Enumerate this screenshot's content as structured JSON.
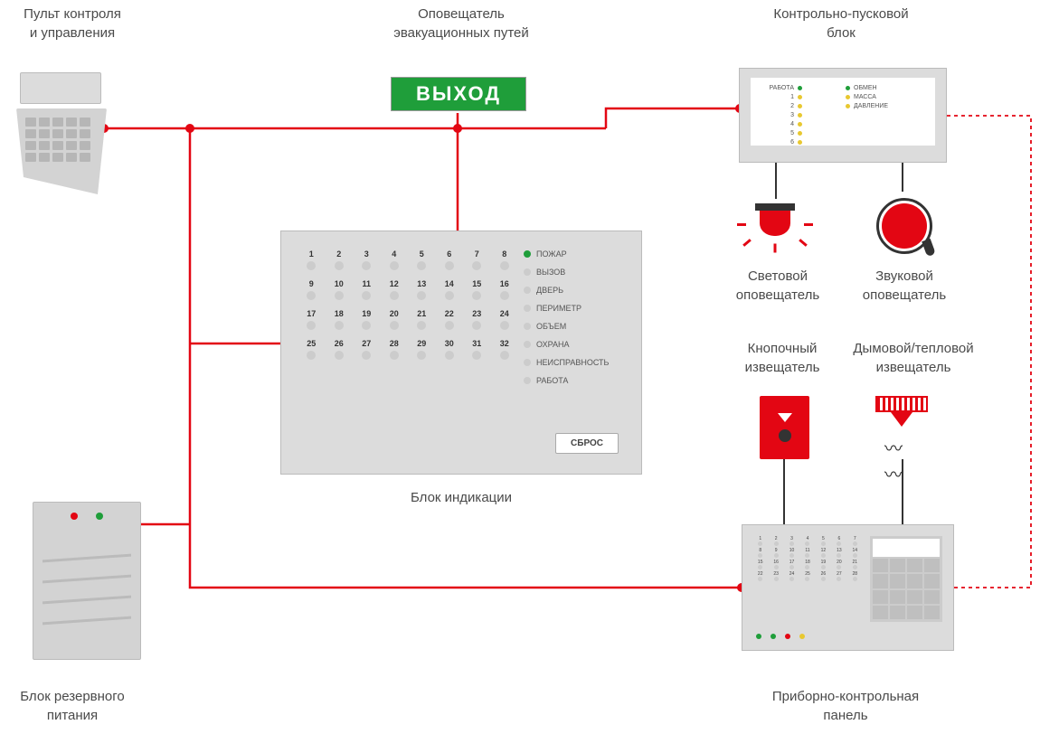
{
  "labels": {
    "keypad": "Пульт контроля\nи управления",
    "exit": "Оповещатель\nэвакуационных путей",
    "ctrl_block": "Контрольно-пусковой\nблок",
    "indication": "Блок индикации",
    "light_ann": "Световой\nоповещатель",
    "sound_ann": "Звуковой\nоповещатель",
    "callpoint": "Кнопочный\nизвещатель",
    "detector": "Дымовой/тепловой\nизвещатель",
    "panel": "Приборно-контрольная\nпанель",
    "ups": "Блок резервного\nпитания"
  },
  "exit_sign_text": "ВЫХОД",
  "ctrl_block": {
    "left_col": [
      "РАБОТА",
      "1",
      "2",
      "3",
      "4",
      "5",
      "6"
    ],
    "right_col": [
      "ОБМЕН",
      "МАССА",
      "ДАВЛЕНИЕ"
    ]
  },
  "indication": {
    "zones": [
      "1",
      "2",
      "3",
      "4",
      "5",
      "6",
      "7",
      "8",
      "9",
      "10",
      "11",
      "12",
      "13",
      "14",
      "15",
      "16",
      "17",
      "18",
      "19",
      "20",
      "21",
      "22",
      "23",
      "24",
      "25",
      "26",
      "27",
      "28",
      "29",
      "30",
      "31",
      "32"
    ],
    "statuses": [
      "ПОЖАР",
      "ВЫЗОВ",
      "ДВЕРЬ",
      "ПЕРИМЕТР",
      "ОБЪЕМ",
      "ОХРАНА",
      "НЕИСПРАВНОСТЬ",
      "РАБОТА"
    ],
    "reset": "СБРОС"
  },
  "panel_numbers": [
    "1",
    "2",
    "3",
    "4",
    "5",
    "6",
    "7",
    "8",
    "9",
    "10",
    "11",
    "12",
    "13",
    "14",
    "15",
    "16",
    "17",
    "18",
    "19",
    "20",
    "21",
    "22",
    "23",
    "24",
    "25",
    "26",
    "27",
    "28"
  ],
  "colors": {
    "red": "#e30613",
    "green": "#1f9e3a",
    "yellow": "#e8c830",
    "grey": "#ccc"
  }
}
